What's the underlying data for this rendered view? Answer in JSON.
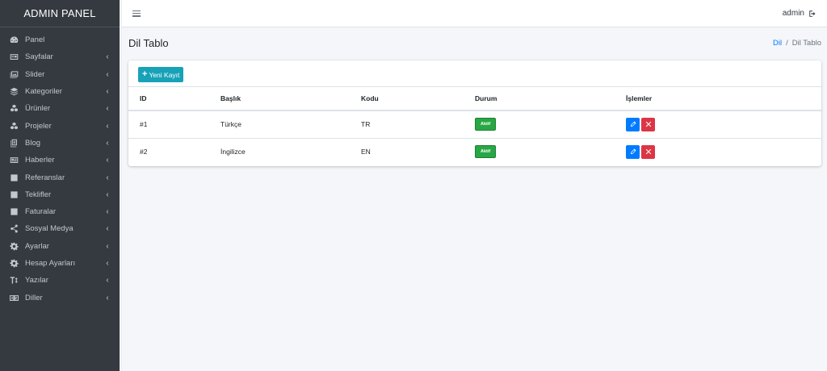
{
  "brand": "ADMIN PANEL",
  "sidebar": {
    "items": [
      {
        "label": "Panel",
        "icon": "dashboard-icon",
        "has_children": false
      },
      {
        "label": "Sayfalar",
        "icon": "id-card-icon",
        "has_children": true
      },
      {
        "label": "Slider",
        "icon": "images-icon",
        "has_children": true
      },
      {
        "label": "Kategoriler",
        "icon": "layers-icon",
        "has_children": true
      },
      {
        "label": "Ürünler",
        "icon": "cubes-icon",
        "has_children": true
      },
      {
        "label": "Projeler",
        "icon": "cubes-icon",
        "has_children": true
      },
      {
        "label": "Blog",
        "icon": "blog-icon",
        "has_children": true
      },
      {
        "label": "Haberler",
        "icon": "newspaper-icon",
        "has_children": true
      },
      {
        "label": "Referanslar",
        "icon": "file-signature-icon",
        "has_children": true
      },
      {
        "label": "Teklifler",
        "icon": "file-signature-icon",
        "has_children": true
      },
      {
        "label": "Faturalar",
        "icon": "file-signature-icon",
        "has_children": true
      },
      {
        "label": "Sosyal Medya",
        "icon": "share-icon",
        "has_children": true
      },
      {
        "label": "Ayarlar",
        "icon": "gear-icon",
        "has_children": true
      },
      {
        "label": "Hesap Ayarları",
        "icon": "gear-icon",
        "has_children": true
      },
      {
        "label": "Yazılar",
        "icon": "text-height-icon",
        "has_children": true
      },
      {
        "label": "Diller",
        "icon": "language-icon",
        "has_children": true
      }
    ],
    "chevron": "‹"
  },
  "navbar": {
    "user": "admin"
  },
  "header": {
    "title": "Dil Tablo",
    "breadcrumb_link": "Dil",
    "breadcrumb_sep": "/",
    "breadcrumb_current": "Dil Tablo"
  },
  "card": {
    "new_button": "Yeni Kayıt",
    "columns": [
      "ID",
      "Başlık",
      "Kodu",
      "Durum",
      "İşlemler"
    ],
    "rows": [
      {
        "id": "#1",
        "title": "Türkçe",
        "code": "TR",
        "status": "Aktif"
      },
      {
        "id": "#2",
        "title": "İngilizce",
        "code": "EN",
        "status": "Aktif"
      }
    ]
  },
  "colors": {
    "sidebar_bg": "#343a40",
    "primary": "#007bff",
    "danger": "#dc3545",
    "success": "#28a745",
    "info": "#17a2b8"
  }
}
